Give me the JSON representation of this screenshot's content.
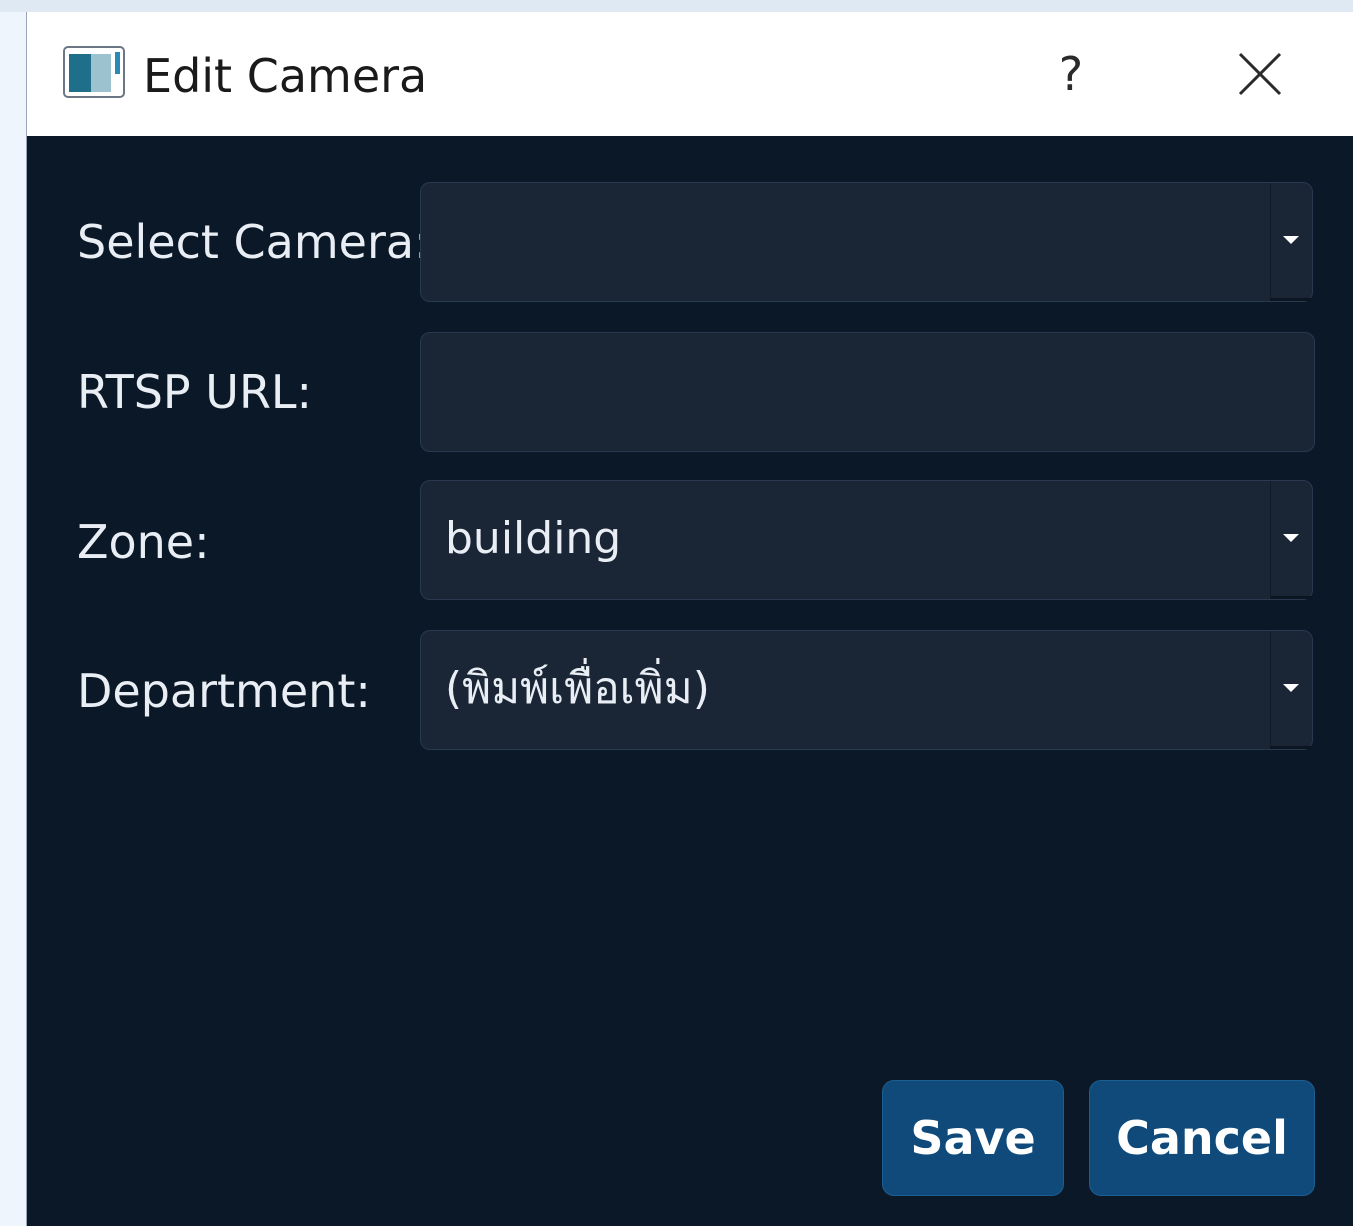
{
  "window": {
    "title": "Edit Camera",
    "help_label": "?",
    "icon": "app-window-icon",
    "close_icon": "close-icon"
  },
  "form": {
    "camera_label": "Select Camera:",
    "camera_value": "",
    "rtsp_label": "RTSP URL:",
    "rtsp_value": "",
    "zone_label": "Zone:",
    "zone_value": "building",
    "department_label": "Department:",
    "department_value": "(พิมพ์เพื่อเพิ่ม)"
  },
  "buttons": {
    "save_label": "Save",
    "cancel_label": "Cancel"
  },
  "colors": {
    "dialog_background": "#0b1827",
    "field_background": "#1a2536",
    "button_background": "#0f4a7a",
    "titlebar_background": "#ffffff"
  }
}
